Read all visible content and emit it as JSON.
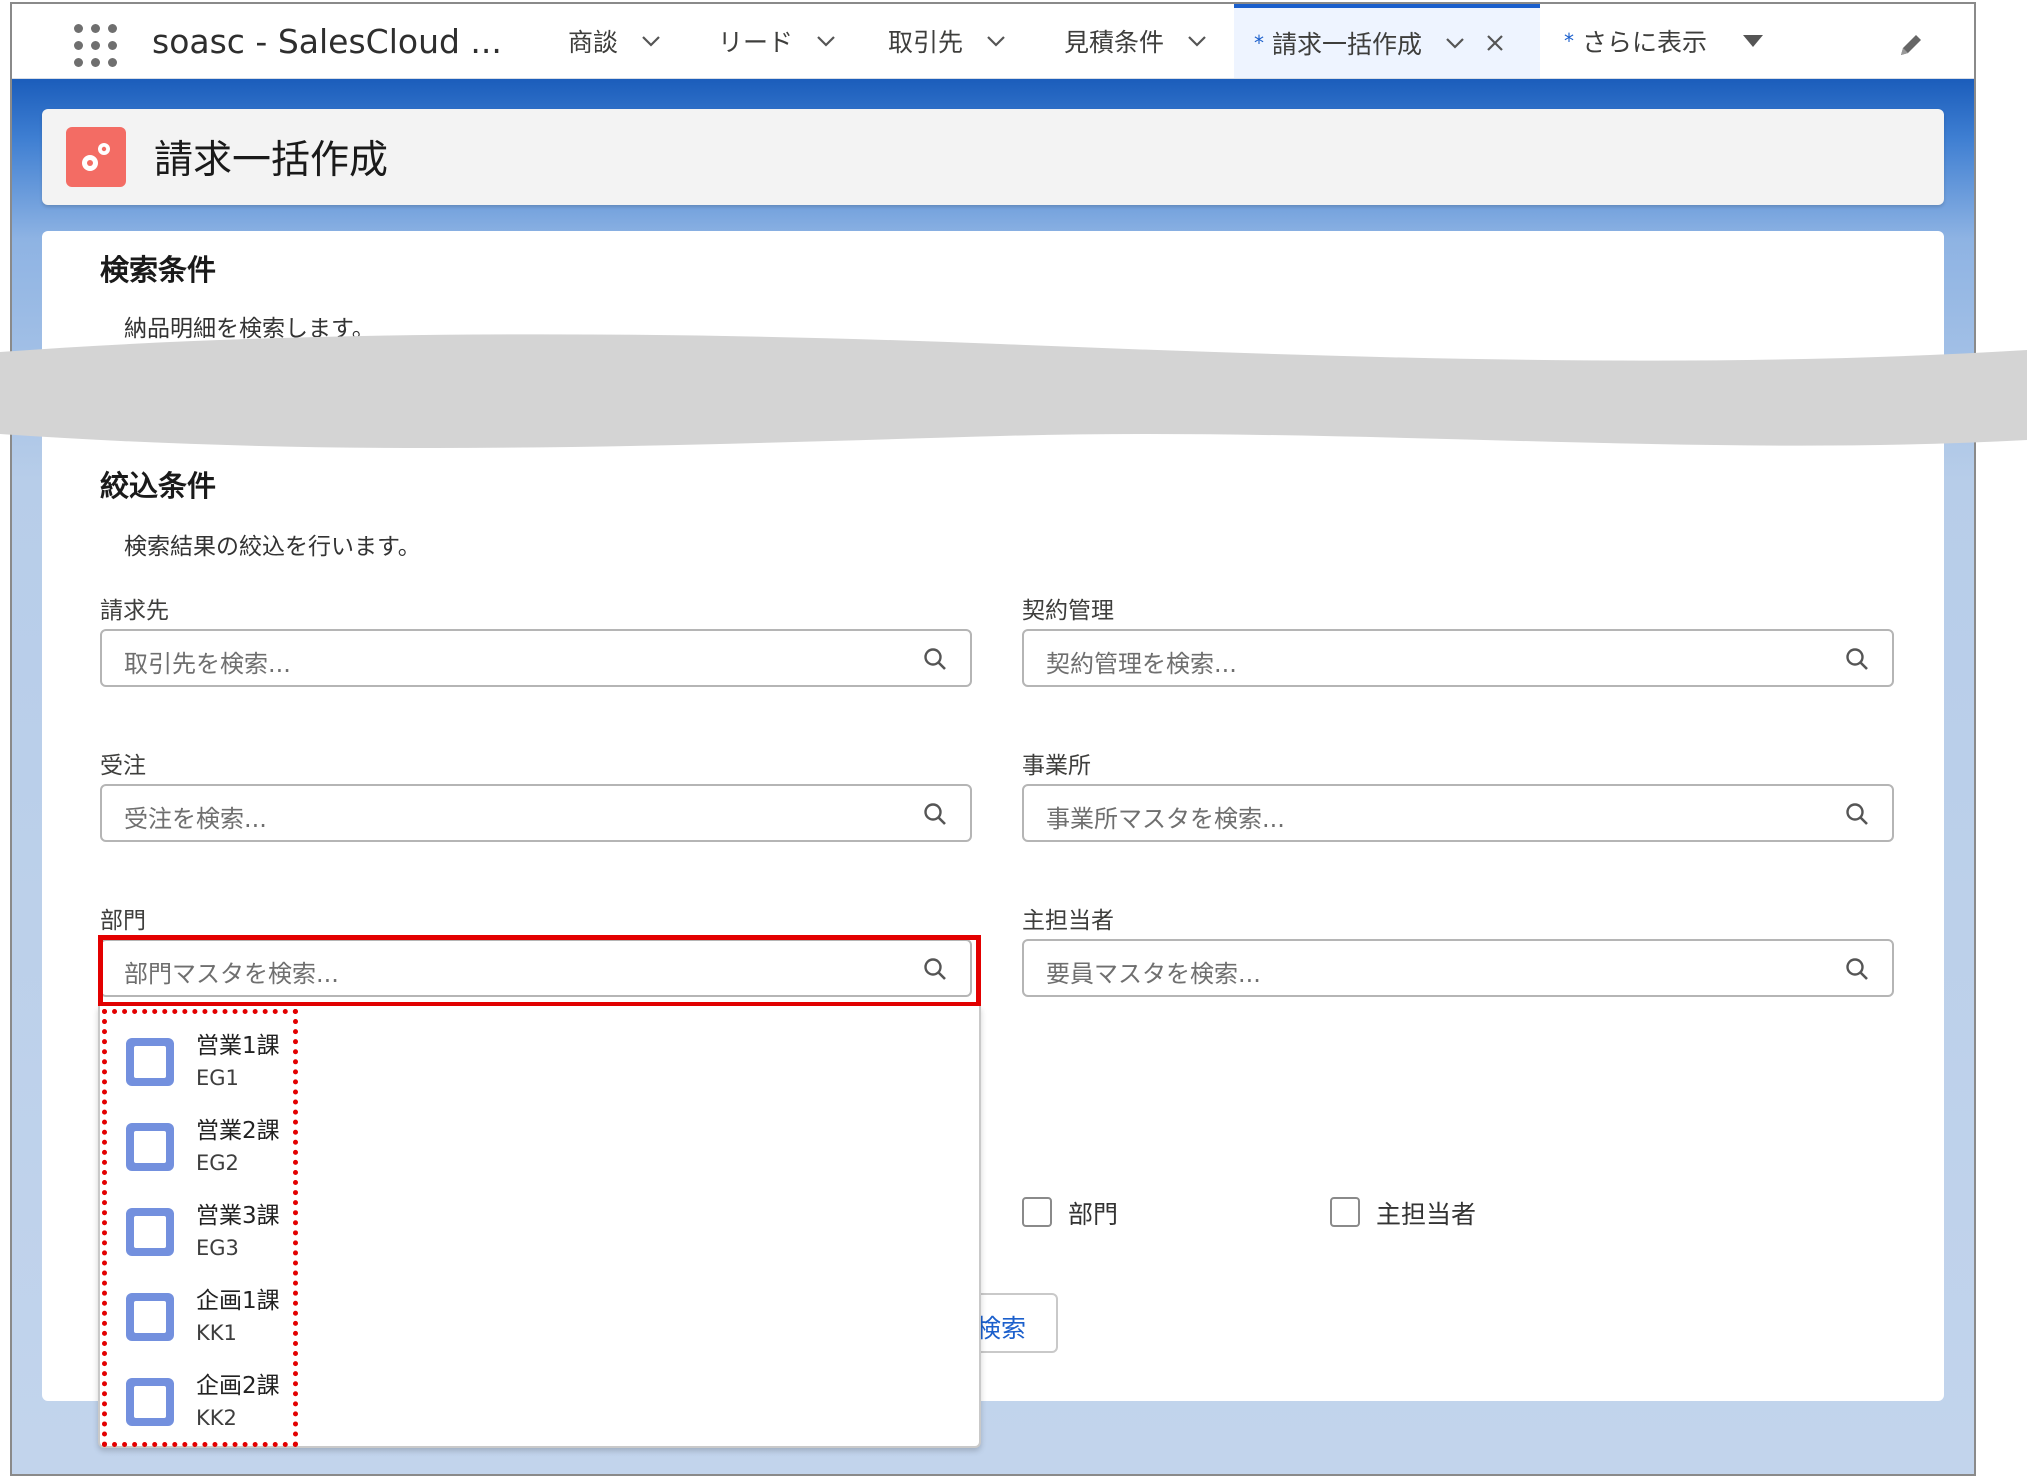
{
  "app": {
    "name": "soasc - SalesCloud ..."
  },
  "nav": {
    "tabs": [
      {
        "label": "商談"
      },
      {
        "label": "リード"
      },
      {
        "label": "取引先"
      },
      {
        "label": "見積条件"
      }
    ],
    "active_tab": {
      "dirty_mark": "*",
      "label": "請求一括作成"
    },
    "more": {
      "dirty_mark": "*",
      "label": "さらに表示"
    }
  },
  "page": {
    "title": "請求一括作成"
  },
  "search_section": {
    "title": "検索条件",
    "description": "納品明細を検索します。"
  },
  "filter_section": {
    "title": "絞込条件",
    "description": "検索結果の絞込を行います。",
    "fields": {
      "billing": {
        "label": "請求先",
        "placeholder": "取引先を検索..."
      },
      "contract": {
        "label": "契約管理",
        "placeholder": "契約管理を検索..."
      },
      "order": {
        "label": "受注",
        "placeholder": "受注を検索..."
      },
      "office": {
        "label": "事業所",
        "placeholder": "事業所マスタを検索..."
      },
      "department": {
        "label": "部門",
        "placeholder": "部門マスタを検索..."
      },
      "owner": {
        "label": "主担当者",
        "placeholder": "要員マスタを検索..."
      }
    },
    "options": [
      {
        "label": "部門",
        "checked": false
      },
      {
        "label": "主担当者",
        "checked": false
      }
    ],
    "search_button": "検索"
  },
  "department_dropdown": {
    "items": [
      {
        "name": "営業1課",
        "code": "EG1"
      },
      {
        "name": "営業2課",
        "code": "EG2"
      },
      {
        "name": "営業3課",
        "code": "EG3"
      },
      {
        "name": "企画1課",
        "code": "KK1"
      },
      {
        "name": "企画2課",
        "code": "KK2"
      }
    ]
  },
  "colors": {
    "accent": "#1b5fcc",
    "header_icon": "#f36c64",
    "highlight": "#e30000",
    "dropdown_icon": "#7390de"
  },
  "icons": {
    "waffle": "app-launcher-icon",
    "chevron": "chevron-down-icon",
    "close": "close-icon",
    "edit": "pencil-icon",
    "search": "search-icon",
    "record": "record-icon"
  }
}
